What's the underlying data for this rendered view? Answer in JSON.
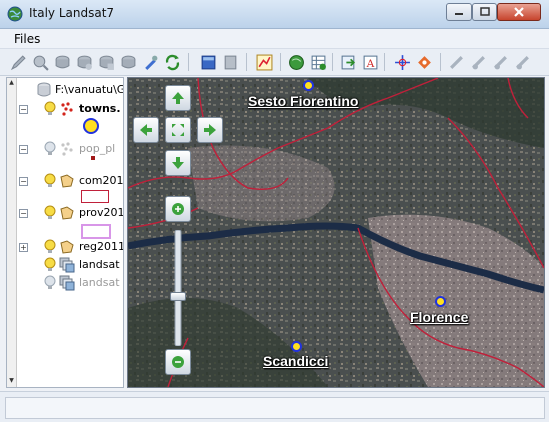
{
  "window": {
    "title": "Italy Landsat7"
  },
  "menu": {
    "files": "Files"
  },
  "toolbar": {
    "icons": [
      "pencil-icon",
      "pan-icon",
      "layer-icon",
      "layer2-icon",
      "layer3-icon",
      "palette-icon",
      "pen-icon",
      "refresh-icon",
      "window-icon",
      "page-icon",
      "chart-icon",
      "globe-icon",
      "table-icon",
      "export-icon",
      "text-icon",
      "crosshair-icon",
      "select-icon",
      "edit-line-icon",
      "edit-node-icon",
      "edit-node2-icon",
      "edit-node3-icon"
    ]
  },
  "layers": {
    "path": "F:\\vanuatu\\Gf",
    "items": [
      {
        "label": "towns.",
        "bold": true,
        "dim": false,
        "expander": "minus",
        "icon": "points"
      },
      {
        "label": "pop_pl",
        "bold": false,
        "dim": true,
        "expander": "minus",
        "icon": "points-dim"
      },
      {
        "label": "com201",
        "bold": false,
        "dim": false,
        "expander": "minus",
        "icon": "polygon"
      },
      {
        "label": "prov201",
        "bold": false,
        "dim": false,
        "expander": "minus",
        "icon": "polygon"
      },
      {
        "label": "reg2011",
        "bold": false,
        "dim": false,
        "expander": "plus",
        "icon": "polygon"
      },
      {
        "label": "landsat",
        "bold": false,
        "dim": false,
        "expander": "",
        "icon": "raster"
      },
      {
        "label": "landsat",
        "bold": false,
        "dim": true,
        "expander": "",
        "icon": "raster"
      }
    ]
  },
  "map": {
    "cities": [
      {
        "name": "Sesto Fiorentino"
      },
      {
        "name": "Florence"
      },
      {
        "name": "Scandicci"
      }
    ],
    "colors": {
      "boundary": "#c0203a",
      "river": "#1c2c46",
      "city_dot": "#ffe020",
      "city_ring": "#2233dd"
    },
    "zoom_level_fraction": 0.55
  }
}
